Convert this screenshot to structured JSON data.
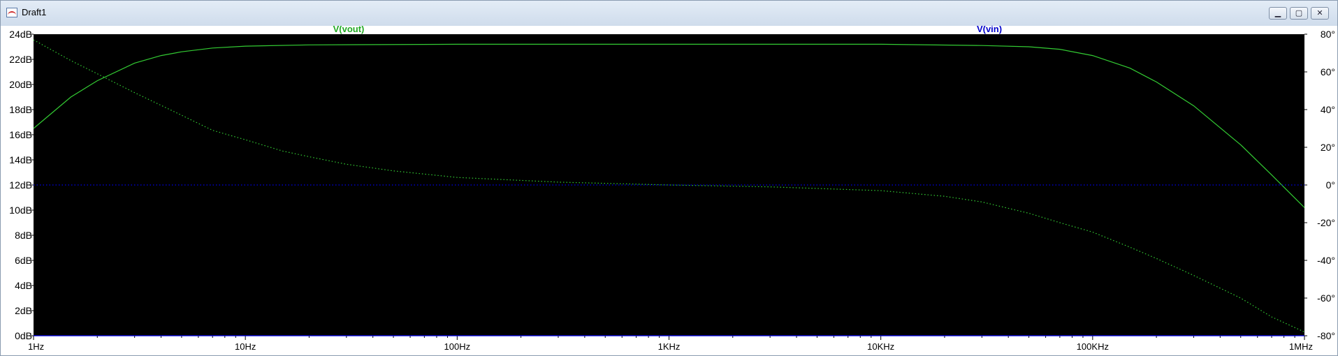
{
  "window": {
    "title": "Draft1",
    "buttons": {
      "minimize": "▁",
      "maximize": "▢",
      "close": "✕"
    }
  },
  "chart_data": {
    "type": "line",
    "x_scale": "log",
    "xlim": [
      1,
      1000000
    ],
    "x_ticks": [
      {
        "value": 1,
        "label": "1Hz"
      },
      {
        "value": 10,
        "label": "10Hz"
      },
      {
        "value": 100,
        "label": "100Hz"
      },
      {
        "value": 1000,
        "label": "1KHz"
      },
      {
        "value": 10000,
        "label": "10KHz"
      },
      {
        "value": 100000,
        "label": "100KHz"
      },
      {
        "value": 1000000,
        "label": "1MHz"
      }
    ],
    "ylim_left": [
      0,
      24
    ],
    "y_ticks_left": [
      {
        "value": 0,
        "label": "0dB"
      },
      {
        "value": 2,
        "label": "2dB"
      },
      {
        "value": 4,
        "label": "4dB"
      },
      {
        "value": 6,
        "label": "6dB"
      },
      {
        "value": 8,
        "label": "8dB"
      },
      {
        "value": 10,
        "label": "10dB"
      },
      {
        "value": 12,
        "label": "12dB"
      },
      {
        "value": 14,
        "label": "14dB"
      },
      {
        "value": 16,
        "label": "16dB"
      },
      {
        "value": 18,
        "label": "18dB"
      },
      {
        "value": 20,
        "label": "20dB"
      },
      {
        "value": 22,
        "label": "22dB"
      },
      {
        "value": 24,
        "label": "24dB"
      }
    ],
    "ylim_right": [
      -80,
      80
    ],
    "y_ticks_right": [
      {
        "value": 80,
        "label": "80°"
      },
      {
        "value": 60,
        "label": "60°"
      },
      {
        "value": 40,
        "label": "40°"
      },
      {
        "value": 20,
        "label": "20°"
      },
      {
        "value": 0,
        "label": "0°"
      },
      {
        "value": -20,
        "label": "-20°"
      },
      {
        "value": -40,
        "label": "-40°"
      },
      {
        "value": -60,
        "label": "-60°"
      },
      {
        "value": -80,
        "label": "-80°"
      }
    ],
    "background": "#000000",
    "series": [
      {
        "name": "V(vout)",
        "color": "#33cc33",
        "magnitude_db": [
          [
            1,
            16.5
          ],
          [
            1.5,
            19.0
          ],
          [
            2,
            20.3
          ],
          [
            3,
            21.7
          ],
          [
            4,
            22.3
          ],
          [
            5,
            22.6
          ],
          [
            7,
            22.9
          ],
          [
            10,
            23.05
          ],
          [
            20,
            23.15
          ],
          [
            100,
            23.2
          ],
          [
            1000,
            23.2
          ],
          [
            10000,
            23.2
          ],
          [
            30000,
            23.1
          ],
          [
            50000,
            23.0
          ],
          [
            70000,
            22.8
          ],
          [
            100000,
            22.3
          ],
          [
            150000,
            21.3
          ],
          [
            200000,
            20.2
          ],
          [
            300000,
            18.3
          ],
          [
            500000,
            15.2
          ],
          [
            700000,
            12.8
          ],
          [
            1000000,
            10.2
          ]
        ],
        "phase_deg": [
          [
            1,
            77
          ],
          [
            1.5,
            66
          ],
          [
            2,
            59
          ],
          [
            3,
            49
          ],
          [
            5,
            37
          ],
          [
            7,
            29
          ],
          [
            10,
            24
          ],
          [
            15,
            18
          ],
          [
            20,
            15
          ],
          [
            30,
            11
          ],
          [
            50,
            7.5
          ],
          [
            100,
            4
          ],
          [
            300,
            1.5
          ],
          [
            1000,
            0
          ],
          [
            3000,
            -1
          ],
          [
            10000,
            -3
          ],
          [
            20000,
            -6
          ],
          [
            30000,
            -9
          ],
          [
            50000,
            -15
          ],
          [
            70000,
            -20
          ],
          [
            100000,
            -25
          ],
          [
            150000,
            -33
          ],
          [
            200000,
            -39
          ],
          [
            300000,
            -48
          ],
          [
            500000,
            -60
          ],
          [
            700000,
            -70
          ],
          [
            1000000,
            -78
          ]
        ]
      },
      {
        "name": "V(vin)",
        "color": "#0000ee",
        "magnitude_db": [
          [
            1,
            0
          ],
          [
            1000000,
            0
          ]
        ],
        "phase_deg": [
          [
            1,
            0
          ],
          [
            1000000,
            0
          ]
        ]
      }
    ]
  }
}
